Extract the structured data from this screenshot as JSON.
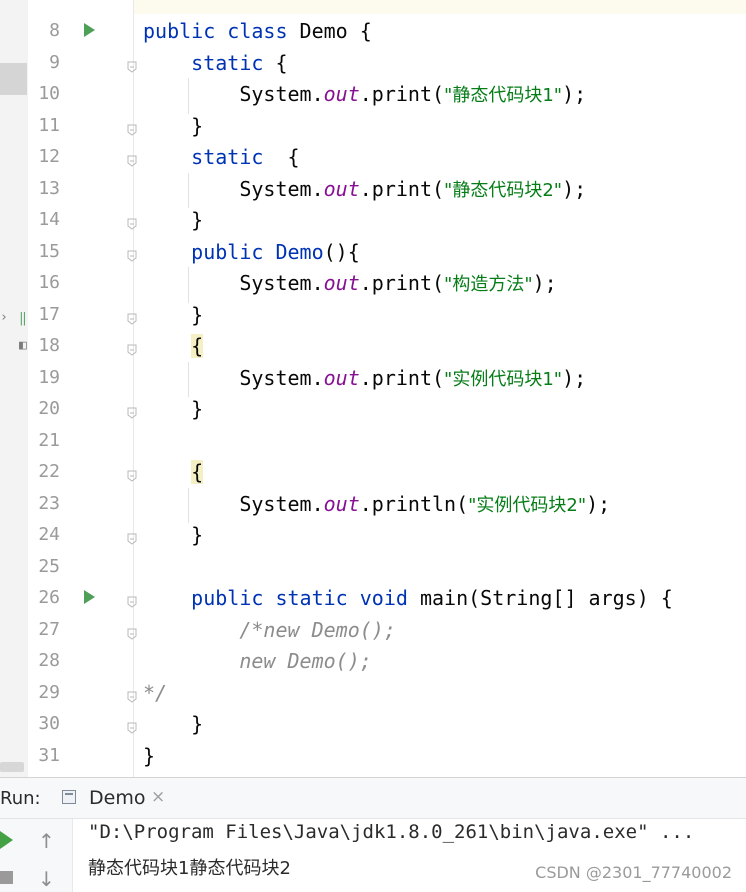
{
  "editor": {
    "lines": [
      {
        "num": "8",
        "segments": [
          {
            "t": "public class ",
            "c": "kw"
          },
          {
            "t": "Demo {",
            "c": ""
          }
        ]
      },
      {
        "num": "9",
        "segments": [
          {
            "t": "    static",
            "c": "kw"
          },
          {
            "t": " {",
            "c": ""
          }
        ]
      },
      {
        "num": "10",
        "segments": [
          {
            "t": "        System.",
            "c": ""
          },
          {
            "t": "out",
            "c": "fld"
          },
          {
            "t": ".print(",
            "c": ""
          },
          {
            "t": "\"静态代码块1\"",
            "c": "str"
          },
          {
            "t": ");",
            "c": ""
          }
        ]
      },
      {
        "num": "11",
        "segments": [
          {
            "t": "    }",
            "c": ""
          }
        ]
      },
      {
        "num": "12",
        "segments": [
          {
            "t": "    static",
            "c": "kw"
          },
          {
            "t": "  {",
            "c": ""
          }
        ]
      },
      {
        "num": "13",
        "segments": [
          {
            "t": "        System.",
            "c": ""
          },
          {
            "t": "out",
            "c": "fld"
          },
          {
            "t": ".print(",
            "c": ""
          },
          {
            "t": "\"静态代码块2\"",
            "c": "str"
          },
          {
            "t": ");",
            "c": ""
          }
        ]
      },
      {
        "num": "14",
        "segments": [
          {
            "t": "    }",
            "c": ""
          }
        ]
      },
      {
        "num": "15",
        "segments": [
          {
            "t": "    public ",
            "c": "kw"
          },
          {
            "t": "Demo",
            "c": "kw"
          },
          {
            "t": "(){",
            "c": ""
          }
        ]
      },
      {
        "num": "16",
        "segments": [
          {
            "t": "        System.",
            "c": ""
          },
          {
            "t": "out",
            "c": "fld"
          },
          {
            "t": ".print(",
            "c": ""
          },
          {
            "t": "\"构造方法\"",
            "c": "str"
          },
          {
            "t": ");",
            "c": ""
          }
        ]
      },
      {
        "num": "17",
        "segments": [
          {
            "t": "    }",
            "c": ""
          }
        ]
      },
      {
        "num": "18",
        "segments": [
          {
            "t": "    ",
            "c": ""
          },
          {
            "t": "{",
            "c": "hl"
          }
        ]
      },
      {
        "num": "19",
        "segments": [
          {
            "t": "        System.",
            "c": ""
          },
          {
            "t": "out",
            "c": "fld"
          },
          {
            "t": ".print(",
            "c": ""
          },
          {
            "t": "\"实例代码块1\"",
            "c": "str"
          },
          {
            "t": ");",
            "c": ""
          }
        ]
      },
      {
        "num": "20",
        "segments": [
          {
            "t": "    }",
            "c": ""
          }
        ]
      },
      {
        "num": "21",
        "segments": [
          {
            "t": "",
            "c": ""
          }
        ]
      },
      {
        "num": "22",
        "segments": [
          {
            "t": "    ",
            "c": ""
          },
          {
            "t": "{",
            "c": "hl"
          }
        ]
      },
      {
        "num": "23",
        "segments": [
          {
            "t": "        System.",
            "c": ""
          },
          {
            "t": "out",
            "c": "fld"
          },
          {
            "t": ".println(",
            "c": ""
          },
          {
            "t": "\"实例代码块2\"",
            "c": "str"
          },
          {
            "t": ");",
            "c": ""
          }
        ]
      },
      {
        "num": "24",
        "segments": [
          {
            "t": "    }",
            "c": ""
          }
        ]
      },
      {
        "num": "25",
        "segments": [
          {
            "t": "",
            "c": ""
          }
        ]
      },
      {
        "num": "26",
        "segments": [
          {
            "t": "    public static void ",
            "c": "kw"
          },
          {
            "t": "main(String[] args) {",
            "c": ""
          }
        ]
      },
      {
        "num": "27",
        "segments": [
          {
            "t": "        /*new Demo();",
            "c": "cm"
          }
        ]
      },
      {
        "num": "28",
        "segments": [
          {
            "t": "        new Demo();",
            "c": "cm"
          }
        ]
      },
      {
        "num": "29",
        "segments": [
          {
            "t": "*/",
            "c": "cm"
          }
        ]
      },
      {
        "num": "30",
        "segments": [
          {
            "t": "    }",
            "c": ""
          }
        ]
      },
      {
        "num": "31",
        "segments": [
          {
            "t": "}",
            "c": ""
          }
        ]
      }
    ]
  },
  "run_panel": {
    "label": "Run:",
    "tab_label": "Demo",
    "tab_close": "×"
  },
  "console": {
    "lines": [
      "\"D:\\Program Files\\Java\\jdk1.8.0_261\\bin\\java.exe\" ...",
      "静态代码块1静态代码块2"
    ]
  },
  "watermark": "CSDN @2301_77740002",
  "colors": {
    "keyword": "#0033b3",
    "field": "#871094",
    "string": "#067d17",
    "comment": "#8c8c8c",
    "run_icon": "#4ea058"
  }
}
